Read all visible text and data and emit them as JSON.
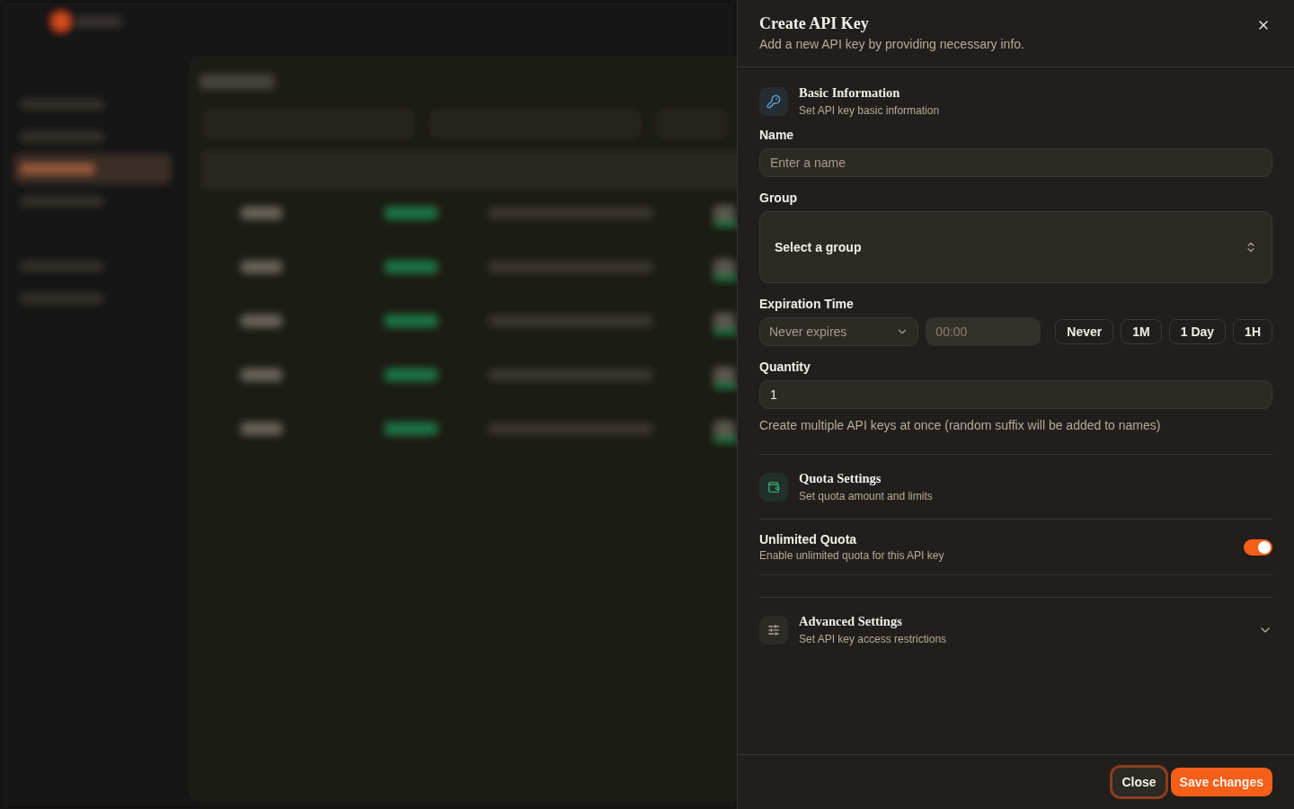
{
  "drawer": {
    "title": "Create API Key",
    "subtitle": "Add a new API key by providing necessary info.",
    "basic": {
      "title": "Basic Information",
      "subtitle": "Set API key basic information"
    },
    "name_field": {
      "label": "Name",
      "placeholder": "Enter a name"
    },
    "group_field": {
      "label": "Group",
      "value": "Select a group"
    },
    "expiration": {
      "label": "Expiration Time",
      "select_value": "Never expires",
      "time_placeholder": "00:00",
      "presets": [
        {
          "label": "Never"
        },
        {
          "label": "1M"
        },
        {
          "label": "1 Day"
        },
        {
          "label": "1H"
        }
      ]
    },
    "quantity": {
      "label": "Quantity",
      "value": "1",
      "hint": "Create multiple API keys at once (random suffix will be added to names)"
    },
    "quota": {
      "title": "Quota Settings",
      "subtitle": "Set quota amount and limits"
    },
    "unlimited": {
      "label": "Unlimited Quota",
      "description": "Enable unlimited quota for this API key",
      "on": true
    },
    "advanced": {
      "title": "Advanced Settings",
      "subtitle": "Set API key access restrictions",
      "expanded": false
    },
    "buttons": [
      {
        "label": "Close",
        "kind": "secondary"
      },
      {
        "label": "Save changes",
        "kind": "primary"
      }
    ]
  }
}
